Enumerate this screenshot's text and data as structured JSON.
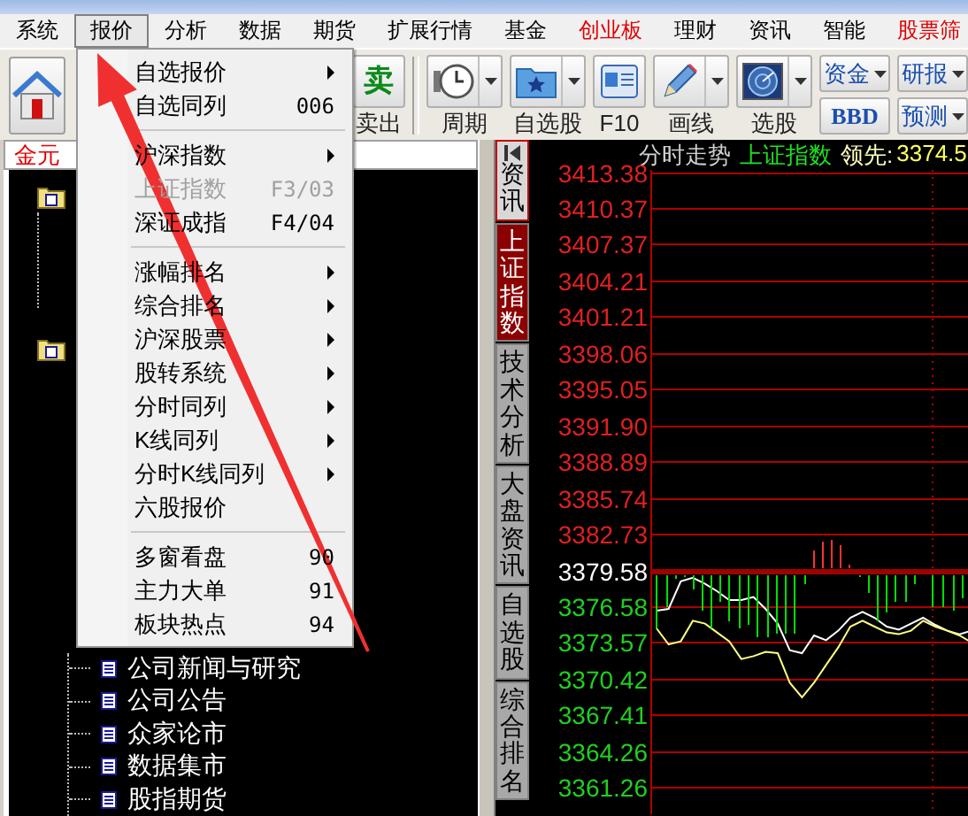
{
  "menubar": [
    {
      "label": "系统",
      "selected": false,
      "color": "#000000"
    },
    {
      "label": "报价",
      "selected": true,
      "color": "#000000"
    },
    {
      "label": "分析",
      "selected": false,
      "color": "#000000"
    },
    {
      "label": "数据",
      "selected": false,
      "color": "#000000"
    },
    {
      "label": "期货",
      "selected": false,
      "color": "#000000"
    },
    {
      "label": "扩展行情",
      "selected": false,
      "color": "#000000"
    },
    {
      "label": "基金",
      "selected": false,
      "color": "#000000"
    },
    {
      "label": "创业板",
      "selected": false,
      "color": "#e00000"
    },
    {
      "label": "理财",
      "selected": false,
      "color": "#000000"
    },
    {
      "label": "资讯",
      "selected": false,
      "color": "#000000"
    },
    {
      "label": "智能",
      "selected": false,
      "color": "#000000"
    },
    {
      "label": "股票筛",
      "selected": false,
      "color": "#e00000"
    }
  ],
  "toolbar": {
    "items": [
      {
        "kind": "glyph",
        "glyph": "卖",
        "label": "卖出"
      },
      {
        "kind": "separator"
      },
      {
        "kind": "dropdown",
        "label": "周期"
      },
      {
        "kind": "dropdown",
        "label": "自选股"
      },
      {
        "kind": "plain",
        "label": "F10"
      },
      {
        "kind": "dropdown",
        "label": "画线"
      },
      {
        "kind": "dropdown",
        "label": "选股"
      }
    ],
    "stacks": [
      {
        "buttons": [
          {
            "label": "资金",
            "dropdown": true,
            "bold": false
          },
          {
            "label": "BBD",
            "dropdown": false,
            "bold": true
          }
        ]
      },
      {
        "buttons": [
          {
            "label": "研报",
            "dropdown": true,
            "bold": false
          },
          {
            "label": "预测",
            "dropdown": true,
            "bold": false
          }
        ]
      }
    ]
  },
  "dropdown_menu": {
    "items": [
      {
        "kind": "submenu",
        "label": "自选报价",
        "disabled": false
      },
      {
        "kind": "shortcut",
        "label": "自选同列",
        "shortcut": "006",
        "disabled": false
      },
      {
        "kind": "separator"
      },
      {
        "kind": "submenu",
        "label": "沪深指数",
        "disabled": false
      },
      {
        "kind": "shortcut",
        "label": "上证指数",
        "shortcut": "F3/03",
        "disabled": true
      },
      {
        "kind": "shortcut",
        "label": "深证成指",
        "shortcut": "F4/04",
        "disabled": false
      },
      {
        "kind": "separator"
      },
      {
        "kind": "submenu",
        "label": "涨幅排名",
        "disabled": false
      },
      {
        "kind": "submenu",
        "label": "综合排名",
        "disabled": false
      },
      {
        "kind": "submenu",
        "label": "沪深股票",
        "disabled": false
      },
      {
        "kind": "submenu",
        "label": "股转系统",
        "disabled": false
      },
      {
        "kind": "submenu",
        "label": "分时同列",
        "disabled": false
      },
      {
        "kind": "submenu",
        "label": "K线同列",
        "disabled": false
      },
      {
        "kind": "submenu",
        "label": "分时K线同列",
        "disabled": false
      },
      {
        "kind": "plain",
        "label": "六股报价",
        "disabled": false
      },
      {
        "kind": "separator"
      },
      {
        "kind": "shortcut",
        "label": "多窗看盘",
        "shortcut": "90",
        "disabled": false
      },
      {
        "kind": "shortcut",
        "label": "主力大单",
        "shortcut": "91",
        "disabled": false
      },
      {
        "kind": "shortcut",
        "label": "板块热点",
        "shortcut": "94",
        "disabled": false
      }
    ]
  },
  "left_panel": {
    "tab": "金元",
    "tree_items": [
      {
        "label": "公司新闻与研究"
      },
      {
        "label": "公司公告"
      },
      {
        "label": "众家论市"
      },
      {
        "label": "数据集市"
      },
      {
        "label": "股指期货"
      }
    ]
  },
  "vertical_tabs": [
    {
      "kind": "toggle",
      "label": "资讯",
      "selected": false
    },
    {
      "kind": "tab",
      "label": "上证指数",
      "selected": true
    },
    {
      "kind": "tab",
      "label": "技术分析",
      "selected": false
    },
    {
      "kind": "tab",
      "label": "大盘资讯",
      "selected": false
    },
    {
      "kind": "tab",
      "label": "自选股",
      "selected": false
    },
    {
      "kind": "tab",
      "label": "综合排名",
      "selected": false
    }
  ],
  "chart": {
    "title": "分时走势",
    "index_name": "上证指数",
    "lead_label": "领先:",
    "lead_value": "3374.5",
    "chart_data": {
      "type": "line",
      "categories": [
        null,
        null,
        null,
        null,
        null,
        null,
        null,
        null,
        null,
        null,
        null,
        null,
        null,
        null,
        null,
        null,
        null,
        null,
        null,
        null,
        null,
        null,
        null,
        null,
        null,
        null,
        null
      ],
      "ylim": [
        3361.26,
        3413.38
      ],
      "yticks": [
        {
          "value": 3413.38,
          "label": "3413.38"
        },
        {
          "value": 3410.37,
          "label": "3410.37"
        },
        {
          "value": 3407.37,
          "label": "3407.37"
        },
        {
          "value": 3404.21,
          "label": "3404.21"
        },
        {
          "value": 3401.21,
          "label": "3401.21"
        },
        {
          "value": 3398.06,
          "label": "3398.06"
        },
        {
          "value": 3395.05,
          "label": "3395.05"
        },
        {
          "value": 3391.9,
          "label": "3391.90"
        },
        {
          "value": 3388.89,
          "label": "3388.89"
        },
        {
          "value": 3385.74,
          "label": "3385.74"
        },
        {
          "value": 3382.73,
          "label": "3382.73"
        },
        {
          "value": 3379.58,
          "label": "3379.58"
        },
        {
          "value": 3376.58,
          "label": "3376.58"
        },
        {
          "value": 3373.57,
          "label": "3373.57"
        },
        {
          "value": 3370.42,
          "label": "3370.42"
        },
        {
          "value": 3367.41,
          "label": "3367.41"
        },
        {
          "value": 3364.26,
          "label": "3364.26"
        },
        {
          "value": 3361.26,
          "label": "3361.26"
        }
      ],
      "series": [
        {
          "color": "#ffffff",
          "values": [
            3376.28,
            3376.43,
            3378.78,
            3379.08,
            3378.57,
            3377.93,
            3377.18,
            3377.18,
            3377.43,
            3376.43,
            3375.18,
            3372.93,
            3372.67,
            3374.17,
            3373.77,
            3374.58,
            3375.68,
            3376.17,
            3375.68,
            3374.93,
            3374.67,
            3375.18,
            3375.68,
            3375.08,
            3374.58,
            3374.28,
            3374.58
          ]
        },
        {
          "color": "#ffff80",
          "values": [
            3374.78,
            3373.42,
            3373.68,
            3375.42,
            3375.18,
            3374.43,
            3373.68,
            3372.18,
            3372.42,
            3372.78,
            3372.67,
            3370.17,
            3368.92,
            3370.17,
            3371.67,
            3373.17,
            3374.93,
            3375.42,
            3374.93,
            3374.43,
            3374.28,
            3374.58,
            3375.42,
            3374.93,
            3374.58,
            3374.17,
            3373.57
          ]
        }
      ],
      "grid": true,
      "ref_lines": [
        {
          "axis": "y",
          "value": 3379.58
        }
      ]
    }
  }
}
